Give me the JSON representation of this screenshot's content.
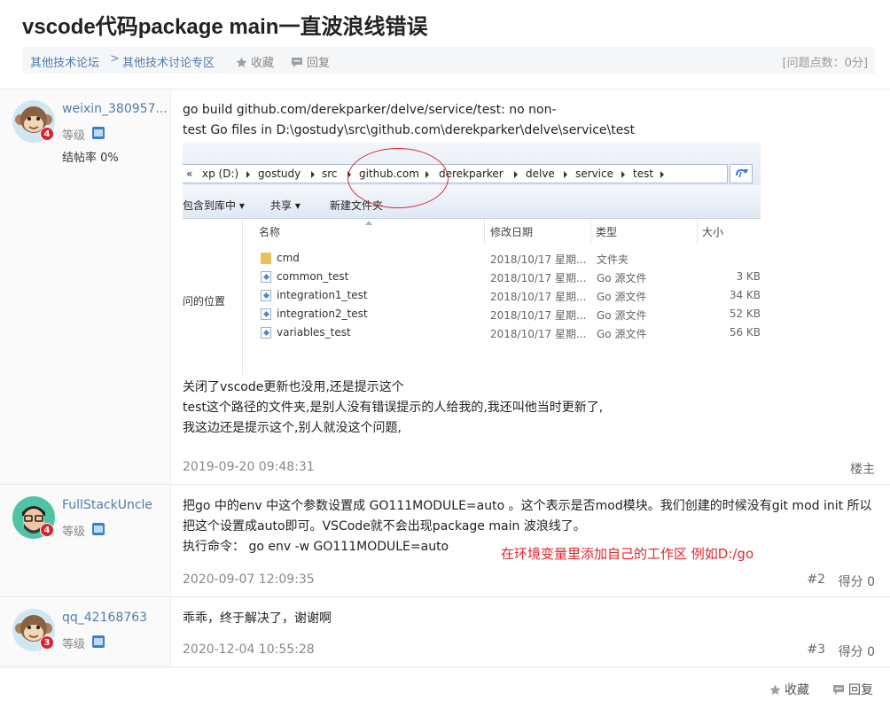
{
  "title": "vscode代码package main一直波浪线错误",
  "breadcrumb": {
    "forum": "其他技术论坛",
    "separator": ">",
    "board": "其他技术讨论专区",
    "collect": "收藏",
    "reply": "回复",
    "score": "[问题点数：0分]"
  },
  "posts": [
    {
      "username": "weixin_380957...",
      "badge": "4",
      "level_label": "等级",
      "rate": "结帖率 0%",
      "lines": [
        "go build github.com/derekparker/delve/service/test: no non-",
        "test Go files in D:\\gostudy\\src\\github.com\\derekparker\\delve\\service\\test"
      ],
      "lines2": [
        "关闭了vscode更新也没用,还是提示这个",
        "test这个路径的文件夹,是别人没有错误提示的人给我的,我还叫他当时更新了,",
        "我这边还是提示这个,别人就没这个问题,"
      ],
      "date": "2019-09-20 09:48:31",
      "floor": "楼主"
    },
    {
      "username": "FullStackUncle",
      "badge": "4",
      "level_label": "等级",
      "lines": [
        "把go 中的env 中这个参数设置成  GO111MODULE=auto  。这个表示是否mod模块。我们创建的时候没有git mod init 所以",
        "把这个设置成auto即可。VSCode就不会出现package main 波浪线了。",
        "执行命令： go env -w GO111MODULE=auto"
      ],
      "note": "在环境变量里添加自己的工作区  例如D:/go",
      "date": "2020-09-07 12:09:35",
      "floor": "#2",
      "score": "得分 0"
    },
    {
      "username": "qq_42168763",
      "badge": "3",
      "level_label": "等级",
      "lines": [
        "乖乖，终于解决了，谢谢啊"
      ],
      "date": "2020-12-04 10:55:28",
      "floor": "#3",
      "score": "得分 0"
    }
  ],
  "explorer": {
    "address_nav": "«",
    "address": [
      "xp (D:)",
      "gostudy",
      "src",
      "github.com",
      "derekparker",
      "delve",
      "service",
      "test"
    ],
    "toolbar": [
      "包含到库中 ▾",
      "共享 ▾",
      "新建文件夹"
    ],
    "left_label": "问的位置",
    "headers": [
      "名称",
      "修改日期",
      "类型",
      "大小"
    ],
    "files": [
      {
        "name": "cmd",
        "date": "2018/10/17 星期...",
        "type": "文件夹",
        "size": "",
        "icon": "folder-icon"
      },
      {
        "name": "common_test",
        "date": "2018/10/17 星期...",
        "type": "Go 源文件",
        "size": "3 KB",
        "icon": "go-file-icon"
      },
      {
        "name": "integration1_test",
        "date": "2018/10/17 星期...",
        "type": "Go 源文件",
        "size": "34 KB",
        "icon": "go-file-icon"
      },
      {
        "name": "integration2_test",
        "date": "2018/10/17 星期...",
        "type": "Go 源文件",
        "size": "52 KB",
        "icon": "go-file-icon"
      },
      {
        "name": "variables_test",
        "date": "2018/10/17 星期...",
        "type": "Go 源文件",
        "size": "56 KB",
        "icon": "go-file-icon"
      }
    ]
  },
  "footer": {
    "collect": "收藏",
    "reply": "回复"
  },
  "colors": {
    "link": "#4f7cad",
    "badge": "#d9232d",
    "note": "#e0262b"
  }
}
